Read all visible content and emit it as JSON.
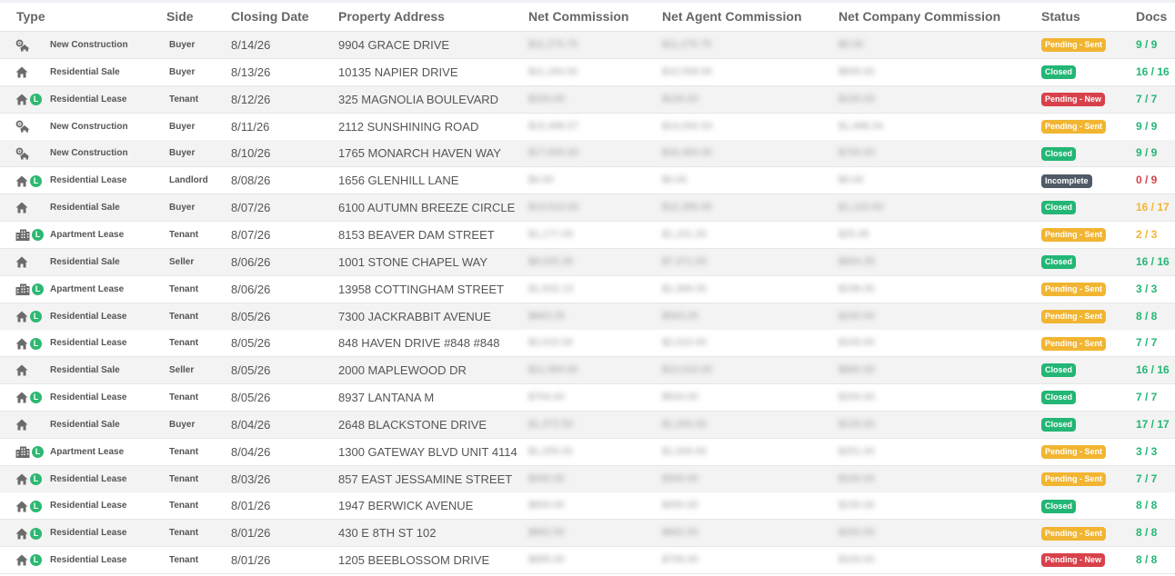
{
  "headers": {
    "type": "Type",
    "side": "Side",
    "closing_date": "Closing Date",
    "property_address": "Property Address",
    "net_commission": "Net Commission",
    "net_agent_commission": "Net Agent Commission",
    "net_company_commission": "Net Company Commission",
    "status": "Status",
    "docs": "Docs"
  },
  "status_colors": {
    "Pending - Sent": "#f2b531",
    "Closed": "#23b675",
    "Pending - New": "#d9414a",
    "Incomplete": "#505a66"
  },
  "docs_colors": {
    "complete": "#23b675",
    "partial": "#f2b531",
    "none": "#d9414a"
  },
  "rows": [
    {
      "icon": "new-construction-icon",
      "type": "New Construction",
      "side": "Buyer",
      "date": "8/14/26",
      "address": "9904 GRACE DRIVE",
      "nc": "$11,275.75",
      "nac": "$11,275.75",
      "ncc": "$0.00",
      "status": "Pending - Sent",
      "docs": "9 / 9",
      "docs_state": "complete"
    },
    {
      "icon": "house-icon",
      "type": "Residential Sale",
      "side": "Buyer",
      "date": "8/13/26",
      "address": "10135 NAPIER DRIVE",
      "nc": "$11,164.00",
      "nac": "$10,558.00",
      "ncc": "$605.00",
      "status": "Closed",
      "docs": "16 / 16",
      "docs_state": "complete"
    },
    {
      "icon": "house-lease-icon",
      "type": "Residential Lease",
      "side": "Tenant",
      "date": "8/12/26",
      "address": "325 MAGNOLIA BOULEVARD",
      "nc": "$200.00",
      "nac": "$100.00",
      "ncc": "$100.00",
      "status": "Pending - New",
      "docs": "7 / 7",
      "docs_state": "complete"
    },
    {
      "icon": "new-construction-icon",
      "type": "New Construction",
      "side": "Buyer",
      "date": "8/11/26",
      "address": "2112 SUNSHINING ROAD",
      "nc": "$15,488.57",
      "nac": "$14,000.53",
      "ncc": "$1,488.04",
      "status": "Pending - Sent",
      "docs": "9 / 9",
      "docs_state": "complete"
    },
    {
      "icon": "new-construction-icon",
      "type": "New Construction",
      "side": "Buyer",
      "date": "8/10/26",
      "address": "1765 MONARCH HAVEN WAY",
      "nc": "$17,000.00",
      "nac": "$16,300.00",
      "ncc": "$700.00",
      "status": "Closed",
      "docs": "9 / 9",
      "docs_state": "complete"
    },
    {
      "icon": "house-lease-icon",
      "type": "Residential Lease",
      "side": "Landlord",
      "date": "8/08/26",
      "address": "1656 GLENHILL LANE",
      "nc": "$0.00",
      "nac": "$0.00",
      "ncc": "$0.00",
      "status": "Incomplete",
      "docs": "0 / 9",
      "docs_state": "none"
    },
    {
      "icon": "house-icon",
      "type": "Residential Sale",
      "side": "Buyer",
      "date": "8/07/26",
      "address": "6100 AUTUMN BREEZE CIRCLE",
      "nc": "$13,510.00",
      "nac": "$12,390.00",
      "ncc": "$1,120.00",
      "status": "Closed",
      "docs": "16 / 17",
      "docs_state": "partial"
    },
    {
      "icon": "apartment-lease-icon",
      "type": "Apartment Lease",
      "side": "Tenant",
      "date": "8/07/26",
      "address": "8153 BEAVER DAM STREET",
      "nc": "$1,177.05",
      "nac": "$1,151.00",
      "ncc": "$25.45",
      "status": "Pending - Sent",
      "docs": "2 / 3",
      "docs_state": "partial"
    },
    {
      "icon": "house-icon",
      "type": "Residential Sale",
      "side": "Seller",
      "date": "8/06/26",
      "address": "1001 STONE CHAPEL WAY",
      "nc": "$8,025.35",
      "nac": "$7,371.00",
      "ncc": "$654.35",
      "status": "Closed",
      "docs": "16 / 16",
      "docs_state": "complete"
    },
    {
      "icon": "apartment-lease-icon",
      "type": "Apartment Lease",
      "side": "Tenant",
      "date": "8/06/26",
      "address": "13958 COTTINGHAM STREET",
      "nc": "$1,502.13",
      "nac": "$1,306.00",
      "ncc": "$196.00",
      "status": "Pending - Sent",
      "docs": "3 / 3",
      "docs_state": "complete"
    },
    {
      "icon": "house-lease-icon",
      "type": "Residential Lease",
      "side": "Tenant",
      "date": "8/05/26",
      "address": "7300 JACKRABBIT AVENUE",
      "nc": "$663.25",
      "nac": "$563.25",
      "ncc": "$100.00",
      "status": "Pending - Sent",
      "docs": "8 / 8",
      "docs_state": "complete"
    },
    {
      "icon": "house-lease-icon",
      "type": "Residential Lease",
      "side": "Tenant",
      "date": "8/05/26",
      "address": "848 HAVEN DRIVE #848 #848",
      "nc": "$2,010.00",
      "nac": "$2,010.00",
      "ncc": "$100.00",
      "status": "Pending - Sent",
      "docs": "7 / 7",
      "docs_state": "complete"
    },
    {
      "icon": "house-icon",
      "type": "Residential Sale",
      "side": "Seller",
      "date": "8/05/26",
      "address": "2000 MAPLEWOOD DR",
      "nc": "$11,064.00",
      "nac": "$10,010.00",
      "ncc": "$860.00",
      "status": "Closed",
      "docs": "16 / 16",
      "docs_state": "complete"
    },
    {
      "icon": "house-lease-icon",
      "type": "Residential Lease",
      "side": "Tenant",
      "date": "8/05/26",
      "address": "8937 LANTANA M",
      "nc": "$700.00",
      "nac": "$500.00",
      "ncc": "$200.00",
      "status": "Closed",
      "docs": "7 / 7",
      "docs_state": "complete"
    },
    {
      "icon": "house-icon",
      "type": "Residential Sale",
      "side": "Buyer",
      "date": "8/04/26",
      "address": "2648 BLACKSTONE DRIVE",
      "nc": "$1,372.50",
      "nac": "$1,200.00",
      "ncc": "$120.00",
      "status": "Closed",
      "docs": "17 / 17",
      "docs_state": "complete"
    },
    {
      "icon": "apartment-lease-icon",
      "type": "Apartment Lease",
      "side": "Tenant",
      "date": "8/04/26",
      "address": "1300 GATEWAY BLVD UNIT 4114",
      "nc": "$1,255.00",
      "nac": "$1,004.00",
      "ncc": "$251.00",
      "status": "Pending - Sent",
      "docs": "3 / 3",
      "docs_state": "complete"
    },
    {
      "icon": "house-lease-icon",
      "type": "Residential Lease",
      "side": "Tenant",
      "date": "8/03/26",
      "address": "857 EAST JESSAMINE STREET",
      "nc": "$400.00",
      "nac": "$300.00",
      "ncc": "$100.00",
      "status": "Pending - Sent",
      "docs": "7 / 7",
      "docs_state": "complete"
    },
    {
      "icon": "house-lease-icon",
      "type": "Residential Lease",
      "side": "Tenant",
      "date": "8/01/26",
      "address": "1947 BERWICK AVENUE",
      "nc": "$600.00",
      "nac": "$450.00",
      "ncc": "$150.00",
      "status": "Closed",
      "docs": "8 / 8",
      "docs_state": "complete"
    },
    {
      "icon": "house-lease-icon",
      "type": "Residential Lease",
      "side": "Tenant",
      "date": "8/01/26",
      "address": "430 E 8TH ST 102",
      "nc": "$862.50",
      "nac": "$662.50",
      "ncc": "$200.00",
      "status": "Pending - Sent",
      "docs": "8 / 8",
      "docs_state": "complete"
    },
    {
      "icon": "house-lease-icon",
      "type": "Residential Lease",
      "side": "Tenant",
      "date": "8/01/26",
      "address": "1205 BEEBLOSSOM DRIVE",
      "nc": "$895.00",
      "nac": "$795.00",
      "ncc": "$100.00",
      "status": "Pending - New",
      "docs": "8 / 8",
      "docs_state": "complete"
    }
  ]
}
